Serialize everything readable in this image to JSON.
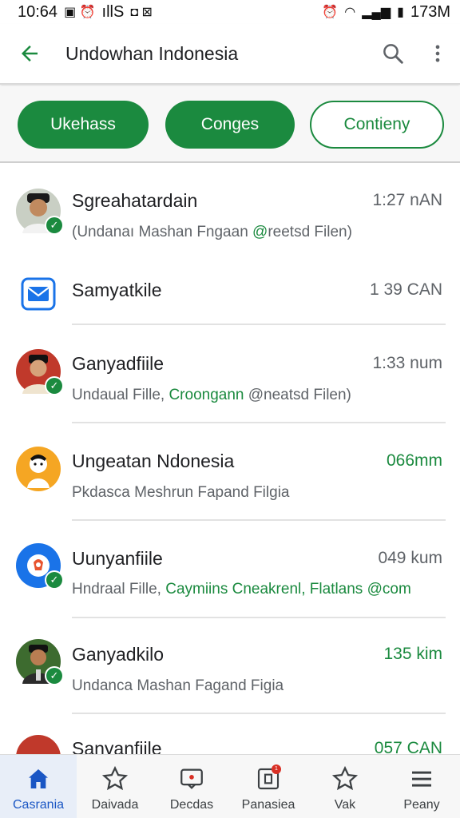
{
  "status_bar": {
    "time": "10:64",
    "left_text": "ıllS",
    "battery_text": "173M"
  },
  "app_bar": {
    "title": "Undowhan Indonesia"
  },
  "chips": [
    {
      "label": "Ukehass",
      "selected": true
    },
    {
      "label": "Conges",
      "selected": true
    },
    {
      "label": "Contieny",
      "selected": false
    }
  ],
  "conversations": [
    {
      "name": "Sgreahatardain",
      "time": "1:27 nAN",
      "time_green": false,
      "preview": "(Undanaı Mashan Fngaan ",
      "preview_accent": "@",
      "preview_tail": "reetsd Filen)",
      "avatar": "person-1",
      "verified": true
    },
    {
      "name": "Samyatkile",
      "time": "1 39 CAN",
      "time_green": false,
      "preview": "",
      "preview_accent": "",
      "preview_tail": "",
      "avatar": "mail",
      "verified": false
    },
    {
      "name": "Ganyadfiile",
      "time": "1:33 num",
      "time_green": false,
      "preview": "Undaual Fille, ",
      "preview_accent": "Croongann",
      "preview_tail": " @neatsd Filen)",
      "avatar": "person-2",
      "verified": true
    },
    {
      "name": "Ungeatan Ndonesia",
      "time": "066mm",
      "time_green": true,
      "preview": "Pkdasca Meshrun Fapand Filgia",
      "preview_accent": "",
      "preview_tail": "",
      "avatar": "cartoon",
      "verified": false
    },
    {
      "name": "Uunyanfiile",
      "time": "049 kum",
      "time_green": false,
      "preview": "Hndraal Fille, ",
      "preview_accent": "Caymiins Cneakrenl, Flatlans @com",
      "preview_tail": "",
      "avatar": "blue-logo",
      "verified": true
    },
    {
      "name": "Ganyadkilo",
      "time": "135 kim",
      "time_green": true,
      "preview": "Undanca Mashan Fagand Figia",
      "preview_accent": "",
      "preview_tail": "",
      "avatar": "person-3",
      "verified": true
    },
    {
      "name": "Sanyanfiile",
      "time": "057 CAN",
      "time_green": true,
      "preview": "",
      "preview_accent": "",
      "preview_tail": "",
      "avatar": "person-4",
      "verified": false
    }
  ],
  "bottom_nav": [
    {
      "label": "Casrania",
      "icon": "home-icon",
      "active": true
    },
    {
      "label": "Daivada",
      "icon": "star-icon",
      "active": false
    },
    {
      "label": "Decdas",
      "icon": "chat-icon",
      "active": false
    },
    {
      "label": "Panasiea",
      "icon": "inbox-icon",
      "active": false,
      "badge": "1"
    },
    {
      "label": "Vak",
      "icon": "star-icon",
      "active": false
    },
    {
      "label": "Peany",
      "icon": "menu-icon",
      "active": false
    }
  ],
  "colors": {
    "accent_green": "#1b8a3f",
    "nav_active_blue": "#1a56c4"
  }
}
